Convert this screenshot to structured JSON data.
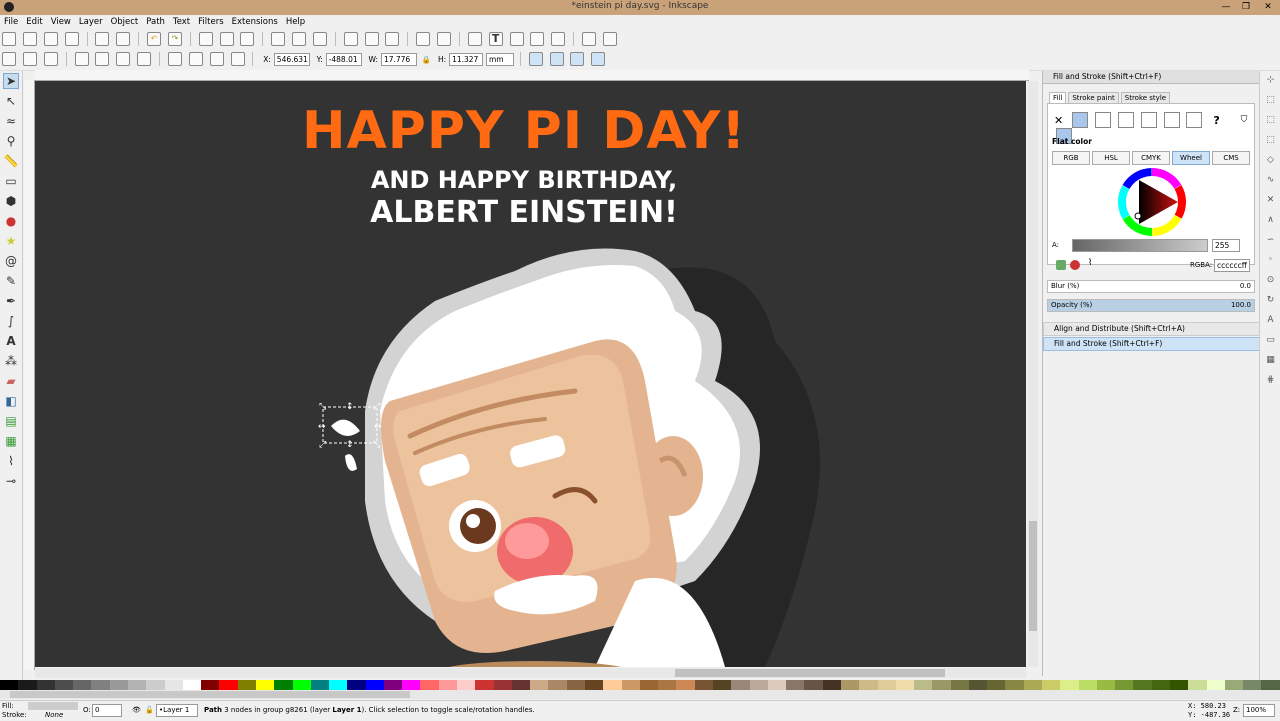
{
  "window": {
    "title": "*einstein pi day.svg - Inkscape",
    "minimize": "—",
    "restore": "❐",
    "close": "✕"
  },
  "menu": [
    "File",
    "Edit",
    "View",
    "Layer",
    "Object",
    "Path",
    "Text",
    "Filters",
    "Extensions",
    "Help"
  ],
  "toolcontrols": {
    "x_label": "X:",
    "x": "546.631",
    "y_label": "Y:",
    "y": "-488.01",
    "w_label": "W:",
    "w": "17.776",
    "h_label": "H:",
    "h": "11.327",
    "unit": "mm"
  },
  "canvas": {
    "headline": "HAPPY PI DAY!",
    "line2": "AND HAPPY BIRTHDAY,",
    "line3": "ALBERT EINSTEIN!",
    "bg": "#333333",
    "headline_color": "#ff6a13"
  },
  "dock": {
    "panel_title": "Fill and Stroke (Shift+Ctrl+F)",
    "tabs": [
      "Fill",
      "Stroke paint",
      "Stroke style"
    ],
    "paint_mode": "Flat color",
    "color_modes": [
      "RGB",
      "HSL",
      "CMYK",
      "Wheel",
      "CMS"
    ],
    "alpha_label": "A:",
    "alpha_value": "255",
    "rgba_label": "RGBA:",
    "rgba_value": "ccccccff",
    "blur_label": "Blur (%)",
    "blur_value": "0.0",
    "opacity_label": "Opacity (%)",
    "opacity_value": "100.0",
    "collapsed1": "Align and Distribute (Shift+Ctrl+A)",
    "collapsed2": "Fill and Stroke (Shift+Ctrl+F)"
  },
  "status": {
    "fill_label": "Fill:",
    "stroke_label": "Stroke:",
    "stroke_value": "None",
    "opacity_label": "O:",
    "opacity_value": "0",
    "layer": "•Layer 1",
    "message_bold": "Path",
    "message": " 3 nodes in group g8261 (layer ",
    "message_layer": "Layer 1",
    "message_end": "). Click selection to toggle scale/rotation handles.",
    "x_coord": "X: 580.23",
    "y_coord": "Y: -487.36",
    "zoom_label": "Z:",
    "zoom": "100%"
  },
  "palette": [
    "#000000",
    "#1a1a1a",
    "#333333",
    "#4d4d4d",
    "#666666",
    "#808080",
    "#999999",
    "#b3b3b3",
    "#cccccc",
    "#e6e6e6",
    "#ffffff",
    "#800000",
    "#ff0000",
    "#808000",
    "#ffff00",
    "#008000",
    "#00ff00",
    "#008080",
    "#00ffff",
    "#000080",
    "#0000ff",
    "#800080",
    "#ff00ff",
    "#ff6666",
    "#ff9999",
    "#ffcccc",
    "#cc3333",
    "#993333",
    "#663333",
    "#ccaa88",
    "#aa8866",
    "#886644",
    "#664422",
    "#ffcc99",
    "#cc9966",
    "#996633",
    "#aa7744",
    "#cc8855",
    "#775533",
    "#554422",
    "#998877",
    "#bbaa99",
    "#ddccbb",
    "#887766",
    "#665544",
    "#443322",
    "#aa9966",
    "#ccbb88",
    "#ddcc99",
    "#eeddaa",
    "#bbbb88",
    "#999966",
    "#777744",
    "#555533",
    "#666633",
    "#888844",
    "#aaaa55",
    "#cccc66",
    "#ddee88",
    "#bbdd66",
    "#99bb44",
    "#779933",
    "#557722",
    "#446611",
    "#335500",
    "#ccdd99",
    "#eeffcc",
    "#99aa77",
    "#778866",
    "#556644"
  ]
}
